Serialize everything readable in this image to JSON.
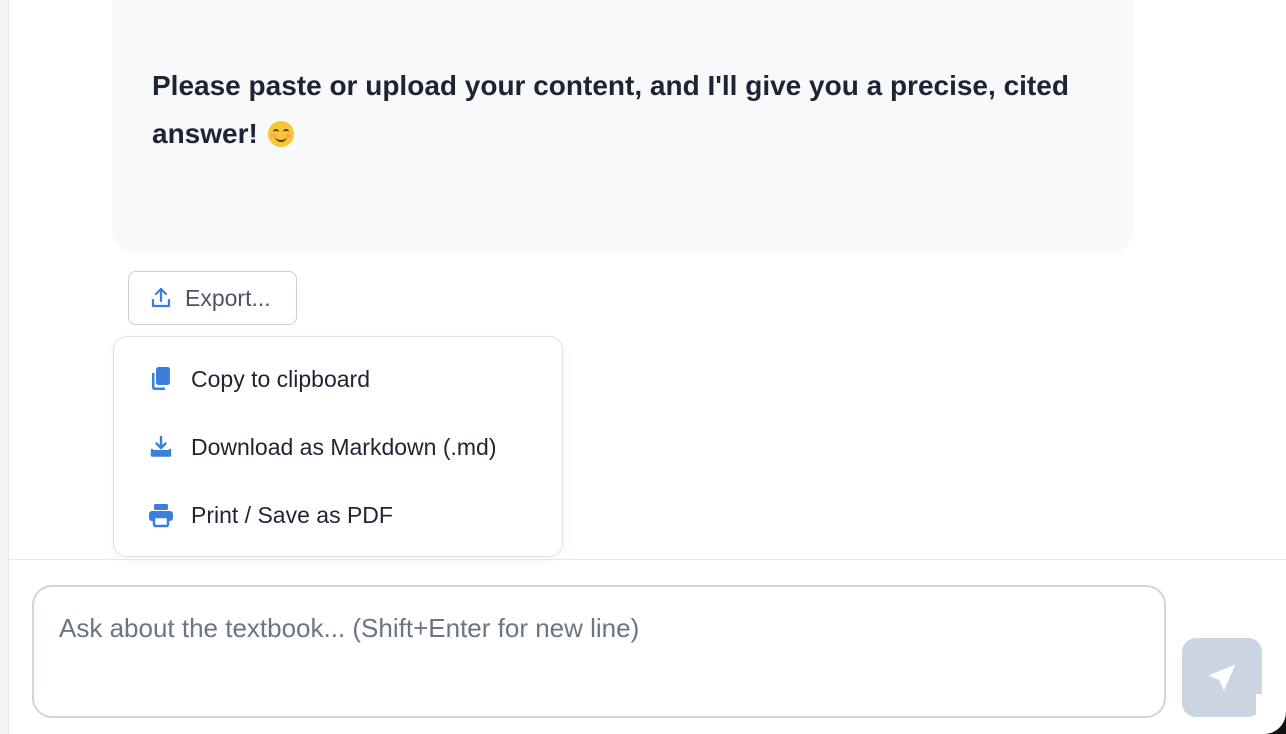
{
  "message": {
    "text": "Please paste or upload your content, and I'll give you a precise, cited answer!",
    "emoji": "😊"
  },
  "export": {
    "label": "Export...",
    "icon": "upload-icon"
  },
  "dropdown": {
    "items": [
      {
        "label": "Copy to clipboard",
        "icon": "copy-icon"
      },
      {
        "label": "Download as Markdown (.md)",
        "icon": "download-icon"
      },
      {
        "label": "Print / Save as PDF",
        "icon": "printer-icon"
      }
    ]
  },
  "composer": {
    "placeholder": "Ask about the textbook... (Shift+Enter for new line)",
    "value": "",
    "send_icon": "send-icon"
  },
  "colors": {
    "accent": "#3b7fdc",
    "text": "#1f2433",
    "send_button": "#cbd5e1"
  }
}
